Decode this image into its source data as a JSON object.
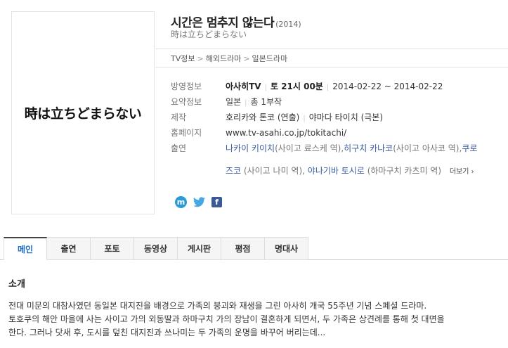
{
  "poster": {
    "text": "時は立ちどまらない"
  },
  "header": {
    "title": "시간은 멈추지 않는다",
    "year": "(2014)",
    "subtitle": "時は立ちどまらない"
  },
  "breadcrumb": [
    "TV정보",
    "해외드라마",
    "일본드라마"
  ],
  "info": {
    "broadcast": {
      "label": "방영정보",
      "channel": "아사히TV",
      "time": "토 21시 00분",
      "dates": "2014-02-22 ~ 2014-02-22"
    },
    "summary": {
      "label": "요약정보",
      "country": "일본",
      "episodes": "총 1부작"
    },
    "production": {
      "label": "제작",
      "directors": "호리카와 톤코 (연출)",
      "writer": "야마다 타이치 (극본)"
    },
    "homepage": {
      "label": "홈페이지",
      "url": "www.tv-asahi.co.jp/tokitachi/"
    },
    "cast": {
      "label": "출연",
      "line1": [
        {
          "name": "나카이 키이치",
          "role": " (사이고 료스케 역), "
        },
        {
          "name": "히구치 카나코",
          "role": " (사이고 아사코 역), "
        },
        {
          "name": "쿠로",
          "role": ""
        }
      ],
      "line2": [
        {
          "name": "즈코",
          "role": " (사이고 나미 역), "
        },
        {
          "name": "야나기바 토시로",
          "role": " (하마구치 카츠미 역)"
        }
      ],
      "more": "더보기 ›"
    }
  },
  "share": {
    "m": "m",
    "twitter": "🐦",
    "facebook": "f"
  },
  "tabs": [
    "메인",
    "출연",
    "포토",
    "동영상",
    "게시판",
    "평점",
    "명대사"
  ],
  "section": {
    "title": "소개",
    "description": [
      "전대 미문의 대참사였던 동일본 대지진을 배경으로 가족의 붕괴와 재생을 그린 아사히 개국 55주년 기념 스페셜 드라마.",
      "토호쿠의 해안 마을에 사는 사이고 가의 외동딸과 하마구치 가의 장남이 결혼하게 되면서, 두 가족은 상견례를 통해 첫 대면을",
      "한다. 그러나 닷새 후, 도시를 덮친 대지진과 쓰나미는 두 가족의 운명을 바꾸어 버리는데..."
    ]
  },
  "colors": {
    "link": "#3a5ba0",
    "active_tab": "#1e6bc5",
    "facebook": "#3b5998",
    "twitter": "#45a7e3"
  }
}
